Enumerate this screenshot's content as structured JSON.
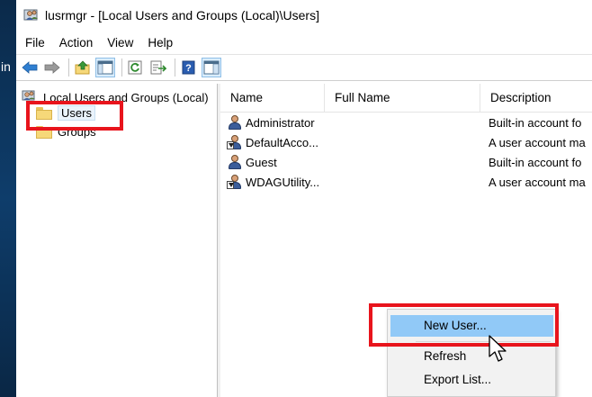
{
  "desktop": {
    "fragment": "in"
  },
  "window": {
    "title": "lusrmgr - [Local Users and Groups (Local)\\Users]"
  },
  "menu": [
    "File",
    "Action",
    "View",
    "Help"
  ],
  "toolbar": {
    "buttons": [
      "back-icon",
      "forward-icon",
      "up-folder-icon",
      "show-hide-tree-icon",
      "refresh-icon",
      "export-list-icon",
      "help-icon",
      "action-pane-icon"
    ]
  },
  "tree": {
    "root": "Local Users and Groups (Local)",
    "items": [
      {
        "label": "Users",
        "selected": true
      },
      {
        "label": "Groups",
        "selected": false
      }
    ]
  },
  "list": {
    "columns": [
      "Name",
      "Full Name",
      "Description"
    ],
    "rows": [
      {
        "name": "Administrator",
        "full_name": "",
        "description": "Built-in account fo",
        "disabled": false
      },
      {
        "name": "DefaultAcco...",
        "full_name": "",
        "description": "A user account ma",
        "disabled": true
      },
      {
        "name": "Guest",
        "full_name": "",
        "description": "Built-in account fo",
        "disabled": false
      },
      {
        "name": "WDAGUtility...",
        "full_name": "",
        "description": "A user account ma",
        "disabled": true
      }
    ]
  },
  "context_menu": {
    "items": [
      "New User...",
      "Refresh",
      "Export List..."
    ],
    "highlighted": "New User..."
  },
  "colors": {
    "highlight_red": "#e8141c",
    "menu_hover": "#91c9f7",
    "folder": "#f6d879"
  }
}
